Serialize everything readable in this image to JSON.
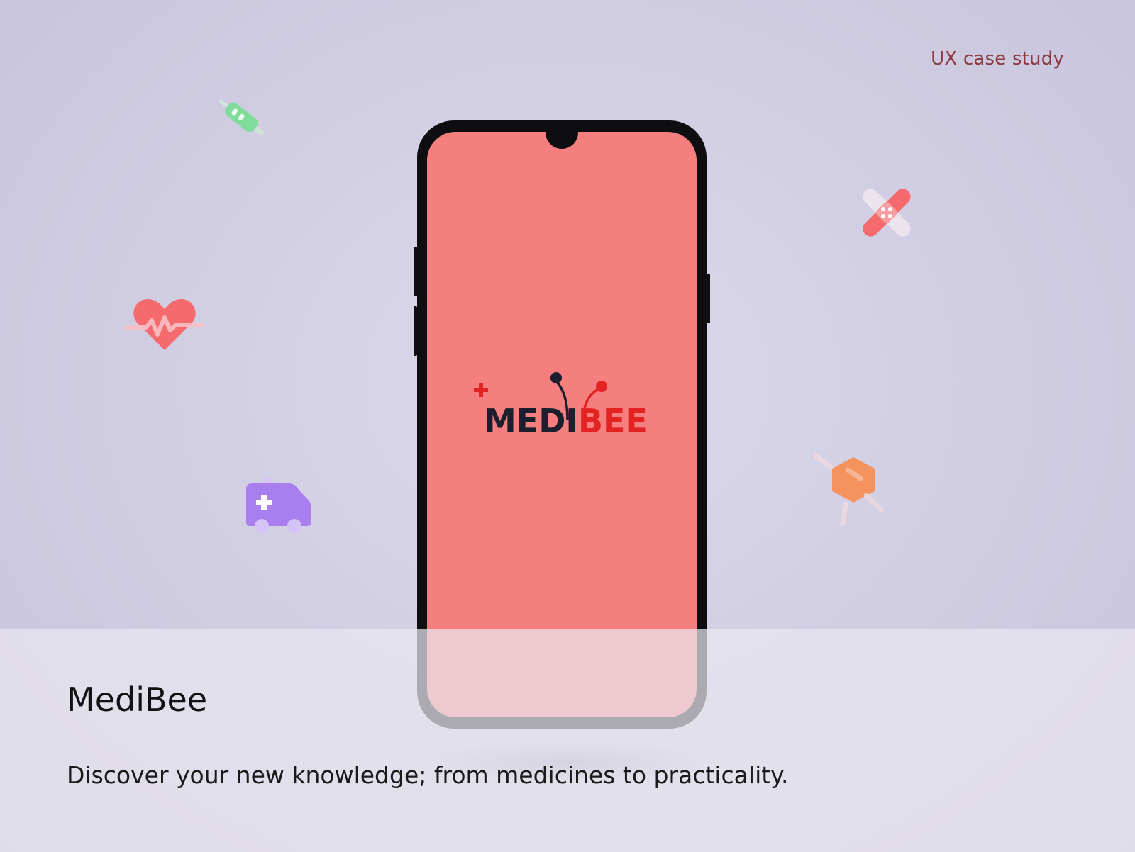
{
  "header": {
    "tag": "UX case study"
  },
  "hero": {
    "title": "MediBee",
    "subtitle": "Discover your new knowledge; from medicines to practicality."
  },
  "phone_screen": {
    "logo_text_dark": "MEDI",
    "logo_text_red": "BEE",
    "background_color": "#f47f7e"
  },
  "decorations": [
    "syringe-icon",
    "bandage-icon",
    "heartbeat-icon",
    "ambulance-icon",
    "pill-icon"
  ],
  "colors": {
    "accent_red": "#e32222",
    "logo_dark": "#1b1f2e",
    "tag_color": "#8a3a3e"
  }
}
